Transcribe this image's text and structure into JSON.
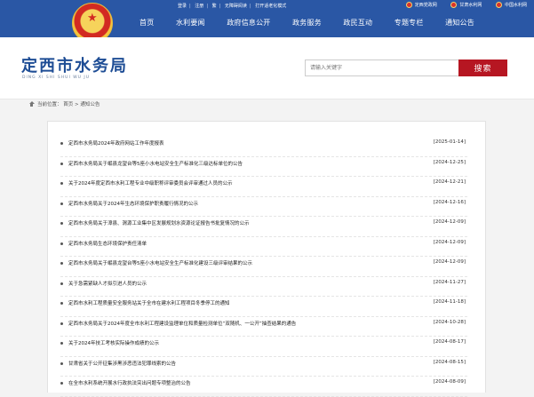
{
  "top_bar": {
    "utility_links": [
      "登录",
      "注册",
      "繁",
      "无障碍阅读",
      "打开适老化模式"
    ],
    "gov_links": [
      "定西党政网",
      "甘肃水利网",
      "中国水利网"
    ]
  },
  "navigation": [
    "首页",
    "水利要闻",
    "政府信息公开",
    "政务服务",
    "政民互动",
    "专题专栏",
    "通知公告"
  ],
  "site": {
    "title": "定西市水务局",
    "subtitle": "DING XI SHI SHUI WU JU"
  },
  "search": {
    "placeholder": "请输入关键字",
    "button_label": "搜索"
  },
  "breadcrumb": {
    "label": "当前位置：",
    "home": "首页",
    "separator": ">",
    "current": "通知公告"
  },
  "notices": [
    {
      "title": "定西市水务局2024年政府网站工作年度报表",
      "date": "[2025-01-14]"
    },
    {
      "title": "定西市水务局关于岷县龙望台等5座小水电站安全生产标准化三级达标单位的公告",
      "date": "[2024-12-25]"
    },
    {
      "title": "关于2024年度定西市水利工程专业中级职称评审委员会评审通过人员的公示",
      "date": "[2024-12-21]"
    },
    {
      "title": "定西市水务局关于2024年生态环境保护职责履行情况的公示",
      "date": "[2024-12-16]"
    },
    {
      "title": "定西市水务局关于漳县、渭源工业集中区发展规划水资源论证报告书批复情况的公示",
      "date": "[2024-12-09]"
    },
    {
      "title": "定西市水务局生态环境保护责任清单",
      "date": "[2024-12-09]"
    },
    {
      "title": "定西市水务局关于岷县龙望台等5座小水电站安全生产标准化建设三级评审结果的公示",
      "date": "[2024-12-09]"
    },
    {
      "title": "关于急需紧缺人才拟引进人员的公示",
      "date": "[2024-11-27]"
    },
    {
      "title": "定西市水利工程质量安全服务站关于全市在建水利工程项目冬季停工的通知",
      "date": "[2024-11-18]"
    },
    {
      "title": "定西市水务局关于2024年度全市水利工程建设监理单位和质量检测单位“双随机、一公开”抽查结果的通告",
      "date": "[2024-10-28]"
    },
    {
      "title": "关于2024年技工考核实际操作成绩的公示",
      "date": "[2024-08-17]"
    },
    {
      "title": "甘肃省关于公开征集涉黑涉恶违法犯罪线索的公告",
      "date": "[2024-08-15]"
    },
    {
      "title": "在全市水利系统开展水行政执法突出问题专项整治的公告",
      "date": "[2024-08-09]"
    }
  ]
}
